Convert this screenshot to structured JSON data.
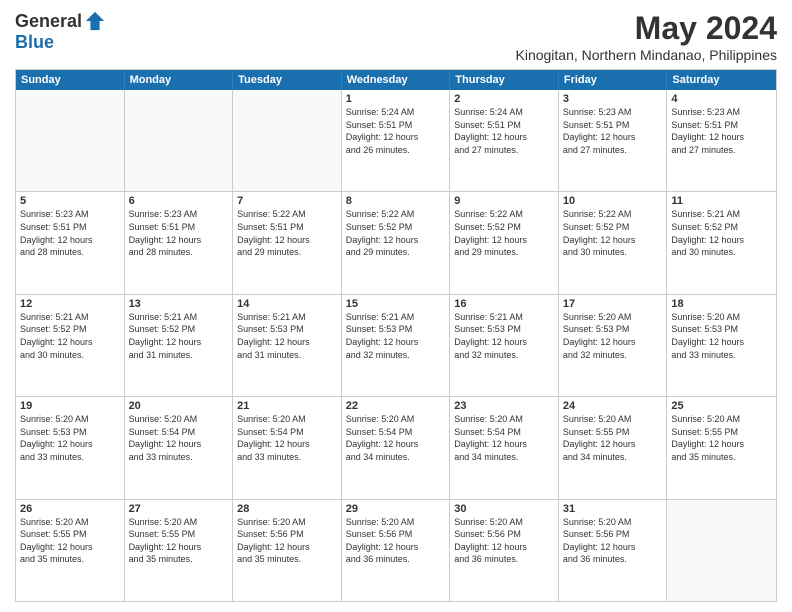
{
  "logo": {
    "general": "General",
    "blue": "Blue"
  },
  "title": "May 2024",
  "subtitle": "Kinogitan, Northern Mindanao, Philippines",
  "header_days": [
    "Sunday",
    "Monday",
    "Tuesday",
    "Wednesday",
    "Thursday",
    "Friday",
    "Saturday"
  ],
  "rows": [
    [
      {
        "day": "",
        "text": ""
      },
      {
        "day": "",
        "text": ""
      },
      {
        "day": "",
        "text": ""
      },
      {
        "day": "1",
        "text": "Sunrise: 5:24 AM\nSunset: 5:51 PM\nDaylight: 12 hours\nand 26 minutes."
      },
      {
        "day": "2",
        "text": "Sunrise: 5:24 AM\nSunset: 5:51 PM\nDaylight: 12 hours\nand 27 minutes."
      },
      {
        "day": "3",
        "text": "Sunrise: 5:23 AM\nSunset: 5:51 PM\nDaylight: 12 hours\nand 27 minutes."
      },
      {
        "day": "4",
        "text": "Sunrise: 5:23 AM\nSunset: 5:51 PM\nDaylight: 12 hours\nand 27 minutes."
      }
    ],
    [
      {
        "day": "5",
        "text": "Sunrise: 5:23 AM\nSunset: 5:51 PM\nDaylight: 12 hours\nand 28 minutes."
      },
      {
        "day": "6",
        "text": "Sunrise: 5:23 AM\nSunset: 5:51 PM\nDaylight: 12 hours\nand 28 minutes."
      },
      {
        "day": "7",
        "text": "Sunrise: 5:22 AM\nSunset: 5:51 PM\nDaylight: 12 hours\nand 29 minutes."
      },
      {
        "day": "8",
        "text": "Sunrise: 5:22 AM\nSunset: 5:52 PM\nDaylight: 12 hours\nand 29 minutes."
      },
      {
        "day": "9",
        "text": "Sunrise: 5:22 AM\nSunset: 5:52 PM\nDaylight: 12 hours\nand 29 minutes."
      },
      {
        "day": "10",
        "text": "Sunrise: 5:22 AM\nSunset: 5:52 PM\nDaylight: 12 hours\nand 30 minutes."
      },
      {
        "day": "11",
        "text": "Sunrise: 5:21 AM\nSunset: 5:52 PM\nDaylight: 12 hours\nand 30 minutes."
      }
    ],
    [
      {
        "day": "12",
        "text": "Sunrise: 5:21 AM\nSunset: 5:52 PM\nDaylight: 12 hours\nand 30 minutes."
      },
      {
        "day": "13",
        "text": "Sunrise: 5:21 AM\nSunset: 5:52 PM\nDaylight: 12 hours\nand 31 minutes."
      },
      {
        "day": "14",
        "text": "Sunrise: 5:21 AM\nSunset: 5:53 PM\nDaylight: 12 hours\nand 31 minutes."
      },
      {
        "day": "15",
        "text": "Sunrise: 5:21 AM\nSunset: 5:53 PM\nDaylight: 12 hours\nand 32 minutes."
      },
      {
        "day": "16",
        "text": "Sunrise: 5:21 AM\nSunset: 5:53 PM\nDaylight: 12 hours\nand 32 minutes."
      },
      {
        "day": "17",
        "text": "Sunrise: 5:20 AM\nSunset: 5:53 PM\nDaylight: 12 hours\nand 32 minutes."
      },
      {
        "day": "18",
        "text": "Sunrise: 5:20 AM\nSunset: 5:53 PM\nDaylight: 12 hours\nand 33 minutes."
      }
    ],
    [
      {
        "day": "19",
        "text": "Sunrise: 5:20 AM\nSunset: 5:53 PM\nDaylight: 12 hours\nand 33 minutes."
      },
      {
        "day": "20",
        "text": "Sunrise: 5:20 AM\nSunset: 5:54 PM\nDaylight: 12 hours\nand 33 minutes."
      },
      {
        "day": "21",
        "text": "Sunrise: 5:20 AM\nSunset: 5:54 PM\nDaylight: 12 hours\nand 33 minutes."
      },
      {
        "day": "22",
        "text": "Sunrise: 5:20 AM\nSunset: 5:54 PM\nDaylight: 12 hours\nand 34 minutes."
      },
      {
        "day": "23",
        "text": "Sunrise: 5:20 AM\nSunset: 5:54 PM\nDaylight: 12 hours\nand 34 minutes."
      },
      {
        "day": "24",
        "text": "Sunrise: 5:20 AM\nSunset: 5:55 PM\nDaylight: 12 hours\nand 34 minutes."
      },
      {
        "day": "25",
        "text": "Sunrise: 5:20 AM\nSunset: 5:55 PM\nDaylight: 12 hours\nand 35 minutes."
      }
    ],
    [
      {
        "day": "26",
        "text": "Sunrise: 5:20 AM\nSunset: 5:55 PM\nDaylight: 12 hours\nand 35 minutes."
      },
      {
        "day": "27",
        "text": "Sunrise: 5:20 AM\nSunset: 5:55 PM\nDaylight: 12 hours\nand 35 minutes."
      },
      {
        "day": "28",
        "text": "Sunrise: 5:20 AM\nSunset: 5:56 PM\nDaylight: 12 hours\nand 35 minutes."
      },
      {
        "day": "29",
        "text": "Sunrise: 5:20 AM\nSunset: 5:56 PM\nDaylight: 12 hours\nand 36 minutes."
      },
      {
        "day": "30",
        "text": "Sunrise: 5:20 AM\nSunset: 5:56 PM\nDaylight: 12 hours\nand 36 minutes."
      },
      {
        "day": "31",
        "text": "Sunrise: 5:20 AM\nSunset: 5:56 PM\nDaylight: 12 hours\nand 36 minutes."
      },
      {
        "day": "",
        "text": ""
      }
    ]
  ]
}
